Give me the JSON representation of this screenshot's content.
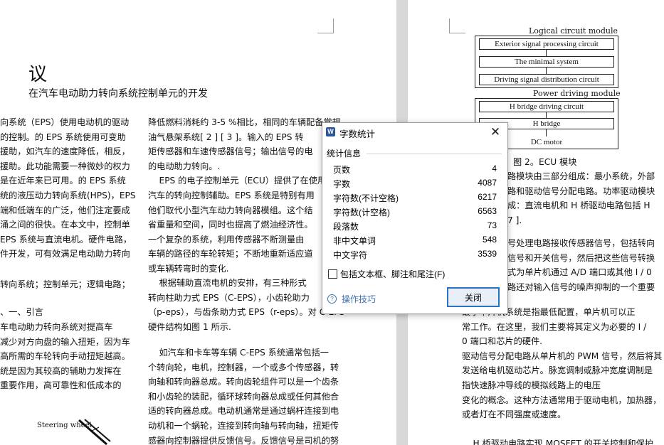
{
  "left_page": {
    "heading_char": "议",
    "subtitle": "在汽车电动助力转向系统控制单元的开发",
    "col1_lines": [
      "向系统（EPS）使用电动机的驱动",
      "的控制。的 EPS 系统使用可变助",
      "援助，如汽车的速度降低，相反，",
      "援助。此功能需要一种微妙的权力",
      "是在近年来已可用。的 EPS 系统",
      "统的液压动力转向系统(HPS)，EPS",
      "端和低端车的广泛，他们注定要成",
      "涌之间的很快。在本文中，控制单",
      "EPS 系统与直流电机。硬件电路，",
      "件开发，可有效满足电动助力转向"
    ],
    "col1_keywords": "转向系统；控制单元；逻辑电路；",
    "col1_section": "、一、引言",
    "col1_lines2": [
      "车电动助力转向系统对提高车",
      "减少对方向盘的输入扭矩，因为车",
      "高所需的车轮转向手动扭矩越高。",
      "统是因为其较高的辅助力发挥在",
      "重要作用，高可靠性和低成本的"
    ],
    "steering_label": "Steering wheel",
    "col2_lines": [
      "降低燃料消耗约 3-5 %相比，相同的车辆配备常规",
      "油气悬架系统[ 2 ] [ 3 ]。输入的 EPS 转",
      "矩传感器和车速传感器信号；输出信号的电",
      "的电动助力转向。.",
      "    EPS 的电子控制单元（ECU）提供了在使用",
      "汽车的转向控制辅助。EPS 系统是特别有用",
      "他们取代小型汽车动力转向器模组。这个结",
      "省重量和空间，同时也提高了燃油经济性。",
      "一个复杂的系统，利用传感器不断测量由",
      "车辆的路径的车轮转矩；不断地重新适应道",
      "或车辆转弯时的变化."
    ],
    "col2_lines2": [
      "    根据辅助直流电机的安排，有三种形式",
      "转向柱助力式 EPS（C-EPS），小齿轮助力",
      "（p-eps），与齿条助力式 EPS（r-eps）。对 C-EPS",
      "硬件结构如图 1 所示."
    ],
    "col2_lines3": [
      "    如汽车和卡车等车辆 C-EPS 系统通常包括一",
      "个转向轮，电机，控制器，一个或多个传感器，转",
      "向轴和转向器总成。转向齿轮组件可以是一个齿条",
      "和小齿轮的装配，循环球转向器总成或任何其他合",
      "适的转向器总成。电动机通常是通过蜗杆连接到电",
      "动机和一个蜗轮，连接到转向轴与转向轴，扭矩传",
      "感器向控制器提供反馈信号。反馈信号是司机的努"
    ]
  },
  "right_page": {
    "diagram": {
      "logical_title": "Logical circuit module",
      "box1": "Exterior signal processing circuit",
      "box2": "The minimal system",
      "box3": "Driving signal distribution circuit",
      "power_title": "Power driving module",
      "box4": "H bridge driving circuit",
      "box5": "H bridge",
      "box6": "DC motor",
      "caption": "图 2。ECU 模块"
    },
    "lines": [
      "路模块由三部分组成：最小系统，外部",
      "路和驱动信号分配电路。功率驱动模块",
      "成：直流电机和 H 桥驱动电路包括 H",
      "7 ]."
    ],
    "lines2": [
      "号处理电路接收传感器信号，包括转向",
      "信号和开关信号，然后把这些信号转换",
      "式为单片机通过 A/D 端口或其他 I / 0",
      "路还对输入信号的噪声抑制的一个重要"
    ],
    "lines3": [
      "最小单片机系统是指最低配置，单片机可以正",
      "常工作。在这里，我们主要将其定义为必要的 I /",
      "0 端口和芯片的硬件.",
      "驱动信号分配电路从单片机的 PWM 信号，然后将其",
      "发送给电机驱动芯片。脉宽调制或脉冲宽度调制是",
      "指快速脉冲导线的模拟线路上的电压",
      "变化的概念。这种方法通常用于驱动电机，加热器，",
      "或者灯在不同强度或速度。",
      "",
      "    H 桥驱动电路实现 MOSFET 的开关控制和保护"
    ]
  },
  "dialog": {
    "title": "字数统计",
    "section": "统计信息",
    "stats": [
      {
        "label": "页数",
        "value": "4"
      },
      {
        "label": "字数",
        "value": "4087"
      },
      {
        "label": "字符数(不计空格)",
        "value": "6217"
      },
      {
        "label": "字符数(计空格)",
        "value": "6563"
      },
      {
        "label": "段落数",
        "value": "73"
      },
      {
        "label": "非中文单词",
        "value": "548"
      },
      {
        "label": "中文字符",
        "value": "3539"
      }
    ],
    "checkbox_label": "包括文本框、脚注和尾注(F)",
    "checkbox_checked": false,
    "tips_label": "操作技巧",
    "close_button": "关闭",
    "accent_color": "#2a72c4"
  }
}
